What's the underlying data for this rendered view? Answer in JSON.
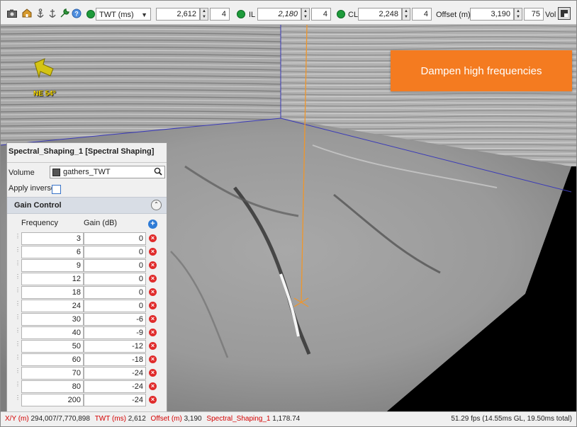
{
  "toolbar": {
    "domain_select": "TWT (ms)",
    "twt_value": "2,612",
    "twt_step": "4",
    "il_label": "IL",
    "il_value": "2,180",
    "il_step": "4",
    "cl_label": "CL",
    "cl_value": "2,248",
    "cl_step": "4",
    "offset_label": "Offset (m)",
    "offset_value": "3,190",
    "offset_step": "75",
    "vol_label": "Vol",
    "icons": [
      "camera-icon",
      "home-icon",
      "anchor-icon",
      "anchor-down-icon",
      "wrench-icon",
      "help-icon"
    ],
    "status_color": "#1e9b3b"
  },
  "viewport": {
    "callout_text": "Dampen high frequencies",
    "callout_color": "#f47b20",
    "compass_label": "NE 54°"
  },
  "panel": {
    "title": "Spectral_Shaping_1 [Spectral Shaping]",
    "volume_label": "Volume",
    "volume_value": "gathers_TWT",
    "apply_inverse_label": "Apply inverse",
    "apply_inverse_checked": false,
    "group_title": "Gain Control",
    "col_frequency": "Frequency",
    "col_gain": "Gain (dB)",
    "rows": [
      {
        "frequency": "3",
        "gain": "0"
      },
      {
        "frequency": "6",
        "gain": "0"
      },
      {
        "frequency": "9",
        "gain": "0"
      },
      {
        "frequency": "12",
        "gain": "0"
      },
      {
        "frequency": "18",
        "gain": "0"
      },
      {
        "frequency": "24",
        "gain": "0"
      },
      {
        "frequency": "30",
        "gain": "-6"
      },
      {
        "frequency": "40",
        "gain": "-9"
      },
      {
        "frequency": "50",
        "gain": "-12"
      },
      {
        "frequency": "60",
        "gain": "-18"
      },
      {
        "frequency": "70",
        "gain": "-24"
      },
      {
        "frequency": "80",
        "gain": "-24"
      },
      {
        "frequency": "200",
        "gain": "-24"
      }
    ]
  },
  "status": {
    "xy_label": "X/Y (m)",
    "xy_value": "294,007/7,770,898",
    "twt_label": "TWT (ms)",
    "twt_value": "2,612",
    "offset_label": "Offset (m)",
    "offset_value": "3,190",
    "attr_label": "Spectral_Shaping_1",
    "attr_value": "1,178.74",
    "fps": "51.29 fps (14.55ms GL, 19.50ms total)"
  }
}
